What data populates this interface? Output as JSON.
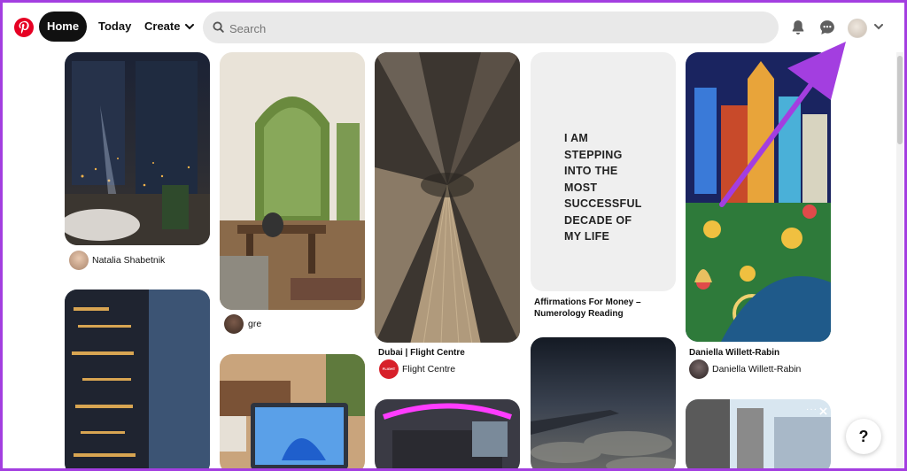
{
  "header": {
    "nav_home": "Home",
    "nav_today": "Today",
    "nav_create": "Create",
    "search_placeholder": "Search"
  },
  "pins": {
    "p1_user": "Natalia Shabetnik",
    "p2_user": "gre",
    "p3_title": "Dubai | Flight Centre",
    "p3_user": "Flight Centre",
    "p3_badge": "FLIGHT CENTRE",
    "p4_text": [
      "I AM",
      "STEPPING",
      "INTO THE",
      "MOST",
      "SUCCESSFUL",
      "DECADE OF",
      "MY LIFE"
    ],
    "p4_title_line1": "Affirmations For Money –",
    "p4_title_line2": "Numerology Reading",
    "p5_title": "Daniella Willett-Rabin",
    "p5_user": "Daniella Willett-Rabin"
  },
  "help_label": "?",
  "colors": {
    "brand": "#e60023",
    "annotation_arrow": "#a33ee0"
  }
}
